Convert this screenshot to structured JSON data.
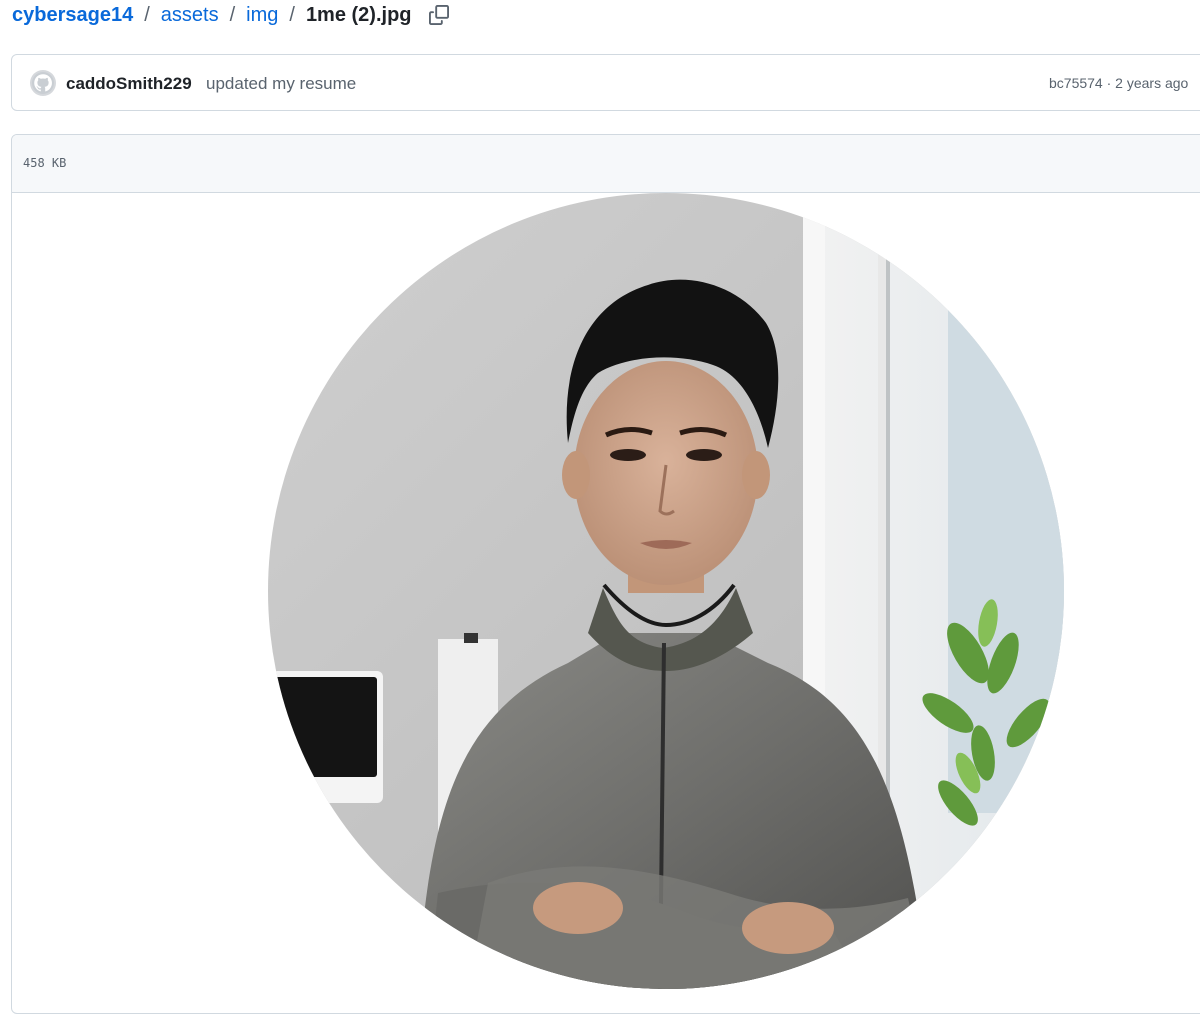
{
  "breadcrumb": {
    "repo": "cybersage14",
    "folder1": "assets",
    "folder2": "img",
    "file": "1me (2).jpg",
    "separator": "/"
  },
  "commit": {
    "author": "caddoSmith229",
    "message": "updated my resume",
    "sha": "bc75574",
    "dot": " · ",
    "age": "2 years ago"
  },
  "file": {
    "size": "458 KB"
  },
  "icons": {
    "copy": "copy-icon",
    "avatar": "github-mark-icon"
  },
  "colors": {
    "link": "#0969da",
    "border": "#d1d9e0",
    "muted": "#59636e",
    "header_bg": "#f6f8fa"
  }
}
